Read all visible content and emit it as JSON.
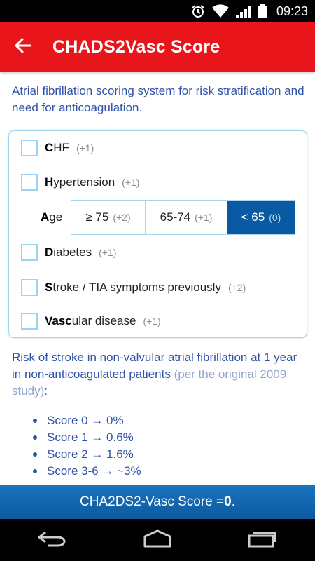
{
  "status_bar": {
    "time": "09:23",
    "icons": [
      "alarm-icon",
      "wifi-icon",
      "signal-icon",
      "battery-icon"
    ]
  },
  "app_bar": {
    "title": "CHADS2Vasc Score",
    "back_icon": "back-arrow-icon",
    "color": "#e8151b"
  },
  "intro": "Atrial fibrillation scoring system for risk stratification and need for anticoagulation.",
  "criteria": {
    "chf": {
      "bold": "C",
      "rest": "HF",
      "points": "(+1)",
      "checked": false
    },
    "hypertension": {
      "bold": "H",
      "rest": "ypertension",
      "points": "(+1)",
      "checked": false
    },
    "diabetes": {
      "bold": "D",
      "rest": "iabetes",
      "points": "(+1)",
      "checked": false
    },
    "stroke": {
      "bold": "S",
      "rest": "troke / TIA symptoms previously",
      "points": "(+2)",
      "checked": false
    },
    "vascular": {
      "bold": "Vasc",
      "rest": "ular disease",
      "points": "(+1)",
      "checked": false
    }
  },
  "age": {
    "label_bold": "A",
    "label_rest": "ge",
    "options": [
      {
        "label": "≥ 75",
        "points": "(+2)"
      },
      {
        "label": "65-74",
        "points": "(+1)"
      },
      {
        "label": "< 65",
        "points": "(0)"
      }
    ],
    "selected": "< 65"
  },
  "risk": {
    "text": "Risk of stroke in non-valvular atrial fibrillation at 1 year in non-anticoagulated patients",
    "muted": "(per the original 2009 study)",
    "end": ":"
  },
  "risk_list": [
    "Score 0 → 0%",
    "Score 1 → 0.6%",
    "Score 2 → 1.6%",
    "Score 3-6 → ~3%"
  ],
  "score_bar": {
    "prefix": "CHA2DS2-Vasc Score = ",
    "value": "0",
    "suffix": ".",
    "color": "#0c5aa0"
  },
  "nav_bar": {
    "icons": [
      "back-icon",
      "home-icon",
      "recent-apps-icon"
    ]
  }
}
